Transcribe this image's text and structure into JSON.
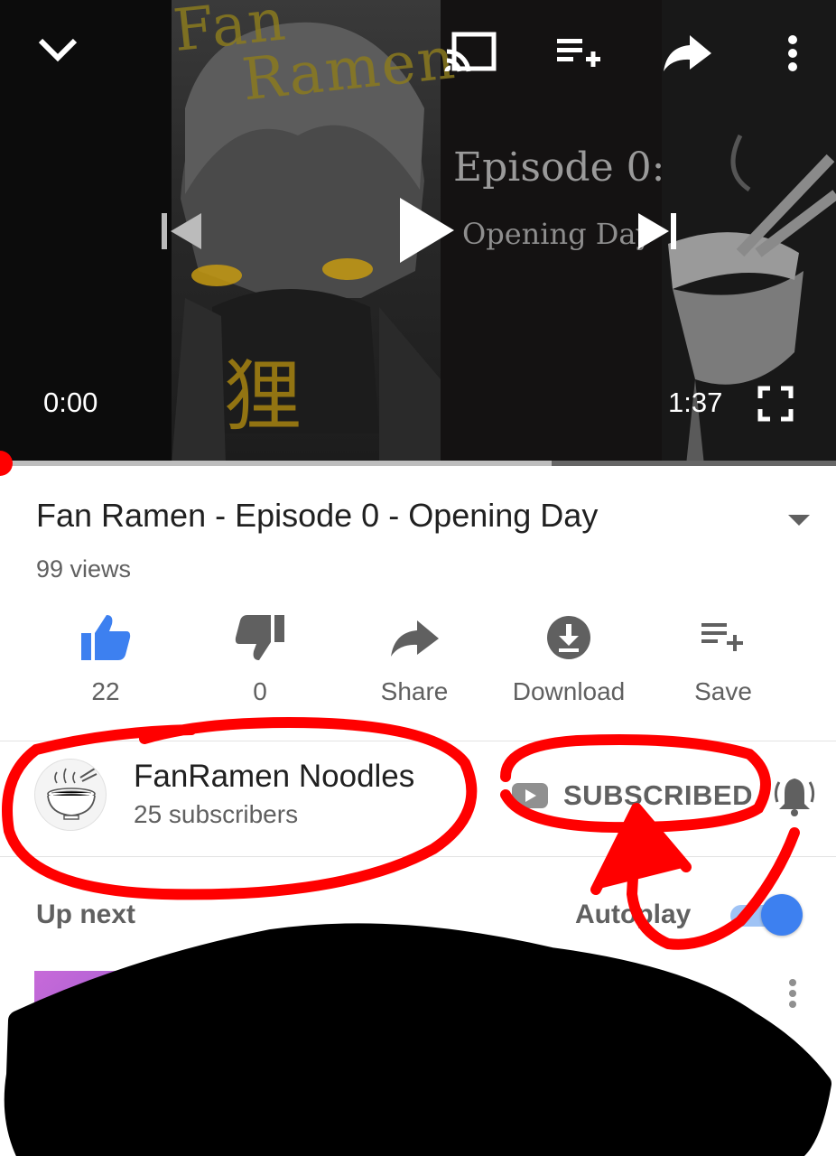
{
  "player": {
    "art_title_line1": "Fan",
    "art_title_line2": "Ramen",
    "art_episode": "Episode 0:",
    "art_subtitle": "Opening Day",
    "art_kanji": "狸",
    "current_time": "0:00",
    "duration": "1:37",
    "progress_fraction": 0.0,
    "buffered_fraction": 0.66
  },
  "video": {
    "title": "Fan Ramen - Episode 0 - Opening Day",
    "views": "99 views"
  },
  "actions": {
    "like_count": "22",
    "dislike_count": "0",
    "share_label": "Share",
    "download_label": "Download",
    "save_label": "Save"
  },
  "channel": {
    "name": "FanRamen Noodles",
    "subscribers": "25 subscribers",
    "subscribe_state": "SUBSCRIBED"
  },
  "upnext": {
    "label": "Up next",
    "autoplay_label": "Autoplay",
    "autoplay_on": true
  },
  "colors": {
    "like_accent": "#3d80f0",
    "progress_red": "#ff0000",
    "annotation_red": "#ff0000"
  }
}
